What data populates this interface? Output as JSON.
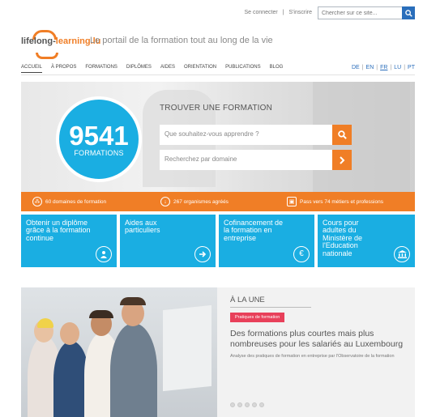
{
  "topbar": {
    "login": "Se connecter",
    "separator": "|",
    "register": "S'inscrire",
    "search_placeholder": "Chercher sur ce site...",
    "search_icon": "search-icon"
  },
  "brand": {
    "name_prefix": "lifelong-",
    "name_suffix": "learning.lu",
    "tagline": "Le portail de la formation tout au long de la vie"
  },
  "nav": {
    "items": [
      "ACCUEIL",
      "À PROPOS",
      "FORMATIONS",
      "DIPLÔMES",
      "AIDES",
      "ORIENTATION",
      "PUBLICATIONS",
      "BLOG"
    ],
    "active": "ACCUEIL"
  },
  "languages": {
    "items": [
      "DE",
      "EN",
      "FR",
      "LU",
      "PT"
    ],
    "active": "FR",
    "separator": "|"
  },
  "hero": {
    "count": "9541",
    "count_label": "FORMATIONS",
    "title": "TROUVER UNE FORMATION",
    "query_placeholder": "Que souhaitez-vous apprendre ?",
    "domain_placeholder": "Recherchez par domaine"
  },
  "stats": {
    "domains": "60 domaines de formation",
    "organisms": "267 organismes agréés",
    "pass": "Pass vers 74 métiers et professions"
  },
  "tiles": [
    {
      "label": "Obtenir un diplôme grâce à la formation continue",
      "icon": "person-icon"
    },
    {
      "label": "Aides aux particuliers",
      "icon": "arrow-right-icon"
    },
    {
      "label": "Cofinancement de la formation en entreprise",
      "icon": "euro-icon"
    },
    {
      "label": "Cours pour adultes du Ministère de l'Education nationale",
      "icon": "building-icon"
    }
  ],
  "news": {
    "section_title": "À LA UNE",
    "badge": "Pratiques de formation",
    "title": "Des formations plus courtes mais plus nombreuses pour les salariés au Luxembourg",
    "description": "Analyse des pratiques de formation en entreprise par l'Observatoire de la formation"
  },
  "colors": {
    "orange": "#f07e26",
    "blue": "#1aaee2",
    "link_blue": "#2a6ebb",
    "badge_pink": "#e8405a"
  }
}
